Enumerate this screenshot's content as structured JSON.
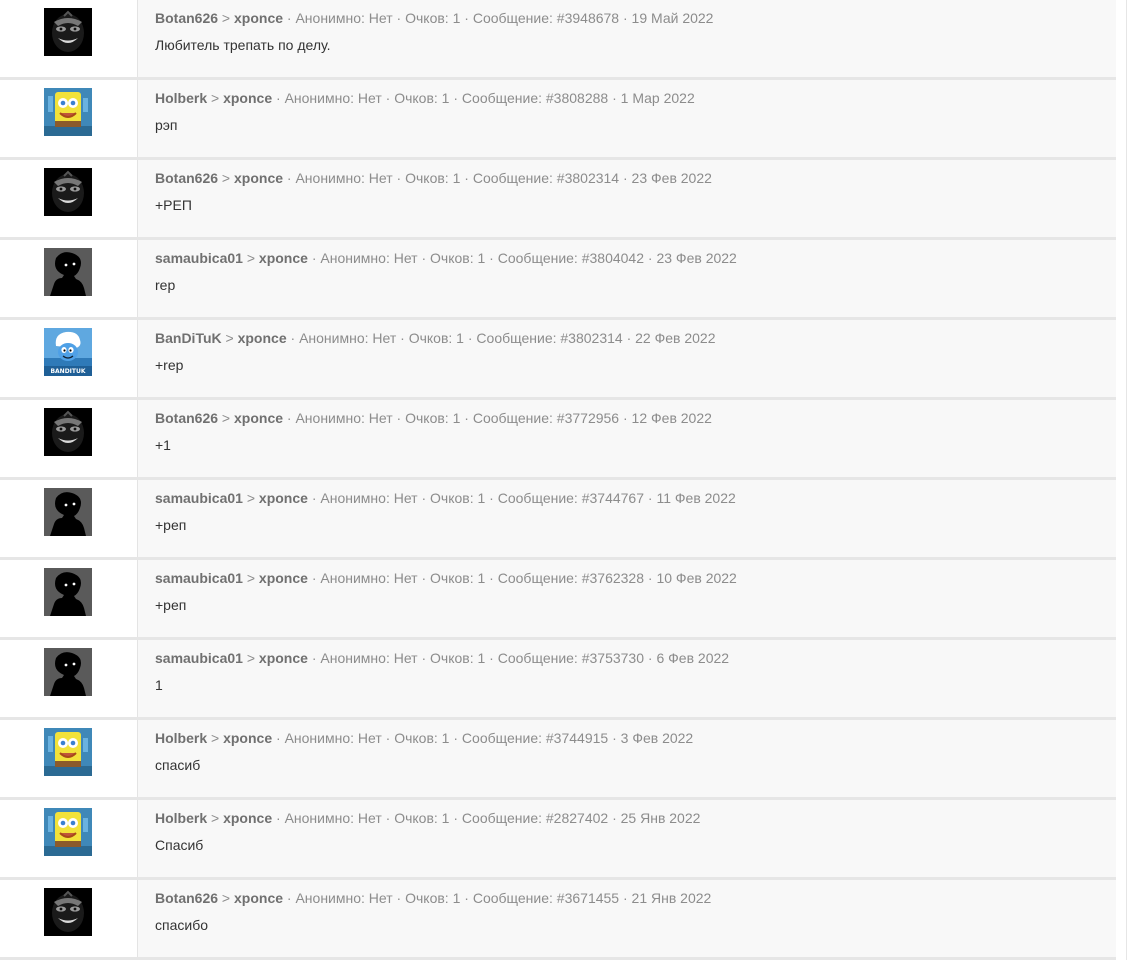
{
  "separator": " · ",
  "arrow": " > ",
  "labels": {
    "anon": "Анонимно: Нет",
    "points": "Очков: 1",
    "message": "Сообщение: "
  },
  "entries": [
    {
      "author": "Botan626",
      "recipient": "xponce",
      "message_id": "#3948678",
      "date": "19 Май 2022",
      "text": "Любитель трепать по делу.",
      "avatar": "dark-face-icon"
    },
    {
      "author": "Holberk",
      "recipient": "xponce",
      "message_id": "#3808288",
      "date": "1 Мар 2022",
      "text": "рэп",
      "avatar": "spongebob-icon"
    },
    {
      "author": "Botan626",
      "recipient": "xponce",
      "message_id": "#3802314",
      "date": "23 Фев 2022",
      "text": "+РЕП",
      "avatar": "dark-face-icon"
    },
    {
      "author": "samaubica01",
      "recipient": "xponce",
      "message_id": "#3804042",
      "date": "23 Фев 2022",
      "text": "rep",
      "avatar": "silhouette-icon"
    },
    {
      "author": "BanDiTuK",
      "recipient": "xponce",
      "message_id": "#3802314",
      "date": "22 Фев 2022",
      "text": "+rep",
      "avatar": "smurf-icon",
      "avatar_text": "BANDITUK"
    },
    {
      "author": "Botan626",
      "recipient": "xponce",
      "message_id": "#3772956",
      "date": "12 Фев 2022",
      "text": "+1",
      "avatar": "dark-face-icon"
    },
    {
      "author": "samaubica01",
      "recipient": "xponce",
      "message_id": "#3744767",
      "date": "11 Фев 2022",
      "text": "+реп",
      "avatar": "silhouette-icon"
    },
    {
      "author": "samaubica01",
      "recipient": "xponce",
      "message_id": "#3762328",
      "date": "10 Фев 2022",
      "text": "+реп",
      "avatar": "silhouette-icon"
    },
    {
      "author": "samaubica01",
      "recipient": "xponce",
      "message_id": "#3753730",
      "date": "6 Фев 2022",
      "text": "1",
      "avatar": "silhouette-icon"
    },
    {
      "author": "Holberk",
      "recipient": "xponce",
      "message_id": "#3744915",
      "date": "3 Фев 2022",
      "text": "спасиб",
      "avatar": "spongebob-icon"
    },
    {
      "author": "Holberk",
      "recipient": "xponce",
      "message_id": "#2827402",
      "date": "25 Янв 2022",
      "text": "Спасиб",
      "avatar": "spongebob-icon"
    },
    {
      "author": "Botan626",
      "recipient": "xponce",
      "message_id": "#3671455",
      "date": "21 Янв 2022",
      "text": "спасибо",
      "avatar": "dark-face-icon"
    }
  ]
}
